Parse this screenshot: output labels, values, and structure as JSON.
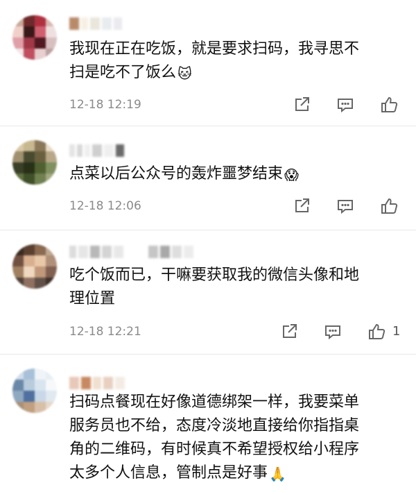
{
  "comments": [
    {
      "lines": [
        "我现在正在吃饭，就是要求扫码，我寻思不",
        "扫是吃不了饭么"
      ],
      "emoji": "🐱",
      "time": "12-18 12:19",
      "like_count": ""
    },
    {
      "lines": [
        "点菜以后公众号的轰炸噩梦结束"
      ],
      "emoji": "😱",
      "time": "12-18 12:06",
      "like_count": ""
    },
    {
      "lines": [
        "吃个饭而已，干嘛要获取我的微信头像和地",
        "理位置"
      ],
      "emoji": "",
      "time": "12-18 12:21",
      "like_count": "1"
    },
    {
      "lines": [
        "扫码点餐现在好像道德绑架一样，我要菜单",
        "服务员也不给，态度冷淡地直接给你指指桌",
        "角的二维码，有时候真不希望授权给小程序",
        "太多个人信息，管制点是好事"
      ],
      "emoji": "🙏",
      "time": "",
      "like_count": ""
    }
  ],
  "icons": {
    "share": "share-icon",
    "reply": "comment-icon",
    "like": "thumbs-up-icon"
  },
  "colors": {
    "text": "#111111",
    "meta": "#8a8a8a",
    "icon": "#666666"
  }
}
